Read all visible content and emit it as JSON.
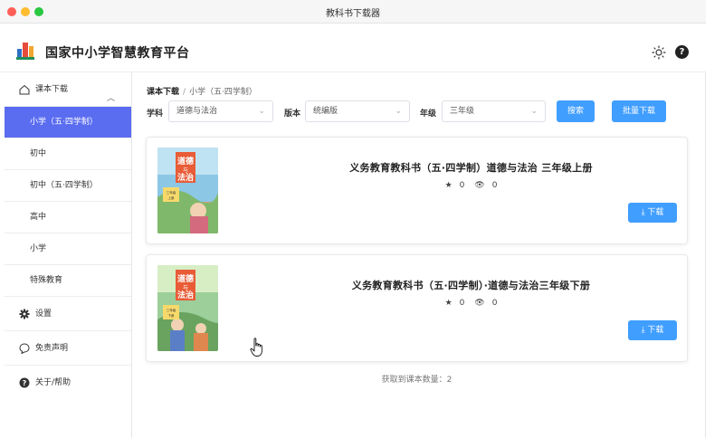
{
  "window": {
    "title": "教科书下载器"
  },
  "header": {
    "app_title": "国家中小学智慧教育平台",
    "theme_icon": "sun-icon",
    "help_icon": "help-icon"
  },
  "sidebar": {
    "parent_label": "课本下载",
    "items": [
      {
        "label": "小学（五·四学制）",
        "active": true
      },
      {
        "label": "初中"
      },
      {
        "label": "初中（五·四学制）"
      },
      {
        "label": "高中"
      },
      {
        "label": "小学"
      },
      {
        "label": "特殊教育"
      }
    ],
    "settings_label": "设置",
    "disclaimer_label": "免责声明",
    "about_label": "关于/帮助"
  },
  "breadcrumb": {
    "root": "课本下载",
    "sep": "/",
    "current": "小学（五·四学制）"
  },
  "filters": {
    "subject_label": "学科",
    "subject_value": "道德与法治",
    "edition_label": "版本",
    "edition_value": "统编版",
    "grade_label": "年级",
    "grade_value": "三年级",
    "search_button": "搜索",
    "batch_button": "批量下载"
  },
  "books": [
    {
      "title": "义务教育教科书（五·四学制）道德与法治 三年级上册",
      "stars": "0",
      "views": "0",
      "download_label": "下载"
    },
    {
      "title": "义务教育教科书（五·四学制）·道德与法治三年级下册",
      "stars": "0",
      "views": "0",
      "download_label": "下载"
    }
  ],
  "footer": {
    "count_text": "获取到课本数量：2"
  },
  "colors": {
    "accent": "#409eff",
    "sidebar_active": "#5a6cf0"
  },
  "cover_text": {
    "title_line1": "道德",
    "title_line2": "与",
    "title_line3": "法治",
    "grade": "三年级",
    "volume_up": "上册",
    "volume_down": "下册"
  }
}
